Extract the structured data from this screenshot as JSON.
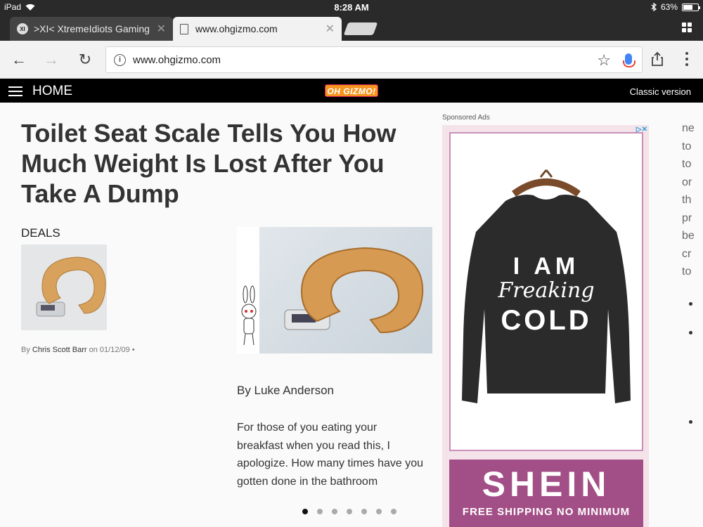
{
  "status_bar": {
    "device": "iPad",
    "time": "8:28 AM",
    "battery": "63%",
    "battery_level": 0.63
  },
  "tabs": [
    {
      "title": ">XI< XtremeIdiots Gaming C",
      "favicon": "XI",
      "active": false
    },
    {
      "title": "www.ohgizmo.com",
      "active": true
    }
  ],
  "toolbar": {
    "url": "www.ohgizmo.com"
  },
  "site_header": {
    "home_label": "HOME",
    "logo_text": "OH GIZMO!",
    "classic_label": "Classic version"
  },
  "article": {
    "title": "Toilet Seat Scale Tells You How Much Weight Is Lost After You Take A Dump",
    "category": "DEALS",
    "by_prefix": "By",
    "author_small": "Chris Scott Barr",
    "on_word": "on",
    "date": "01/12/09",
    "byline_large": "By Luke Anderson",
    "body": "For those of you eating your breakfast when you read this, I apologize. How many times have you gotten done in the bathroom",
    "carousel_dots": 7,
    "carousel_active_index": 0
  },
  "ad": {
    "sponsored_label": "Sponsored Ads",
    "sweater_line1": "I AM",
    "sweater_line2": "Freaking",
    "sweater_line3": "COLD",
    "brand": "SHEIN",
    "tagline": "FREE SHIPPING NO MINIMUM"
  },
  "right_column_fragments": [
    "ne",
    "to",
    "to",
    "or",
    "th",
    "pr",
    "be",
    "cr",
    "to"
  ],
  "colors": {
    "header_bg": "#000000",
    "logo_orange": "#f7941d",
    "shein_purple": "#a34f87",
    "ad_pink": "#f4e4ea"
  }
}
